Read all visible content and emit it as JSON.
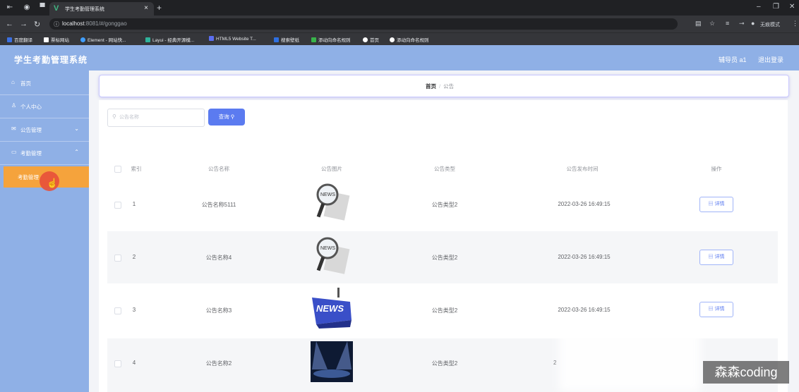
{
  "browser": {
    "tab_title": "学生考勤管理系统",
    "tab_close": "×",
    "new_tab": "+",
    "url_host": "localhost",
    "url_path": ":8081/#/gonggao",
    "incognito_label": "无痕模式",
    "bookmarks": [
      {
        "label": "百度翻译",
        "color": "#3b6fe0"
      },
      {
        "label": "票标网站",
        "color": "#ffffff"
      },
      {
        "label": "Element - 网站快...",
        "color": "#409eff"
      },
      {
        "label": "Layui - 经典开源模...",
        "color": "#2fb29b"
      },
      {
        "label": "HTML5 Website T...",
        "color": "#5b6ef0"
      },
      {
        "label": "搜索壁纸",
        "color": "#2e6fe0"
      },
      {
        "label": "添动向命名规则",
        "color": "#38b44a"
      },
      {
        "label": "首页",
        "color": "#ffffff"
      },
      {
        "label": "添动向命名规则",
        "color": "#ffffff"
      }
    ]
  },
  "header": {
    "title": "学生考勤管理系统",
    "user": "辅导员 a1",
    "logout": "退出登录"
  },
  "sidebar": {
    "items": [
      {
        "label": "首页",
        "icon": "home-icon"
      },
      {
        "label": "个人中心",
        "icon": "user-icon"
      },
      {
        "label": "公告管理",
        "icon": "notice-icon"
      },
      {
        "label": "考勤管理",
        "icon": "attendance-icon"
      }
    ],
    "submenu_active": "考勤管理"
  },
  "breadcrumb": {
    "home": "首页",
    "separator": "/",
    "current": "公告"
  },
  "search": {
    "placeholder": "公告名称",
    "value": "",
    "button": "查询"
  },
  "table": {
    "columns": [
      "索引",
      "公告名称",
      "公告图片",
      "公告类型",
      "公告发布时间",
      "操作"
    ],
    "rows": [
      {
        "index": "1",
        "name": "公告名称5111",
        "image": "magnifier-news-image",
        "type": "公告类型2",
        "time": "2022-03-26 16:49:15",
        "action": "详情"
      },
      {
        "index": "2",
        "name": "公告名称4",
        "image": "magnifier-news-image",
        "type": "公告类型2",
        "time": "2022-03-26 16:49:15",
        "action": "详情"
      },
      {
        "index": "3",
        "name": "公告名称3",
        "image": "news-key-image",
        "type": "公告类型2",
        "time": "2022-03-26 16:49:15",
        "action": "详情"
      },
      {
        "index": "4",
        "name": "公告名称2",
        "image": "stage-image",
        "type": "公告类型2",
        "time": "2",
        "action": ""
      }
    ]
  },
  "watermark": "森森coding",
  "colors": {
    "header_bg": "#8fb0e6",
    "active_menu": "#f5a33c",
    "primary_button": "#5b7bf0"
  }
}
